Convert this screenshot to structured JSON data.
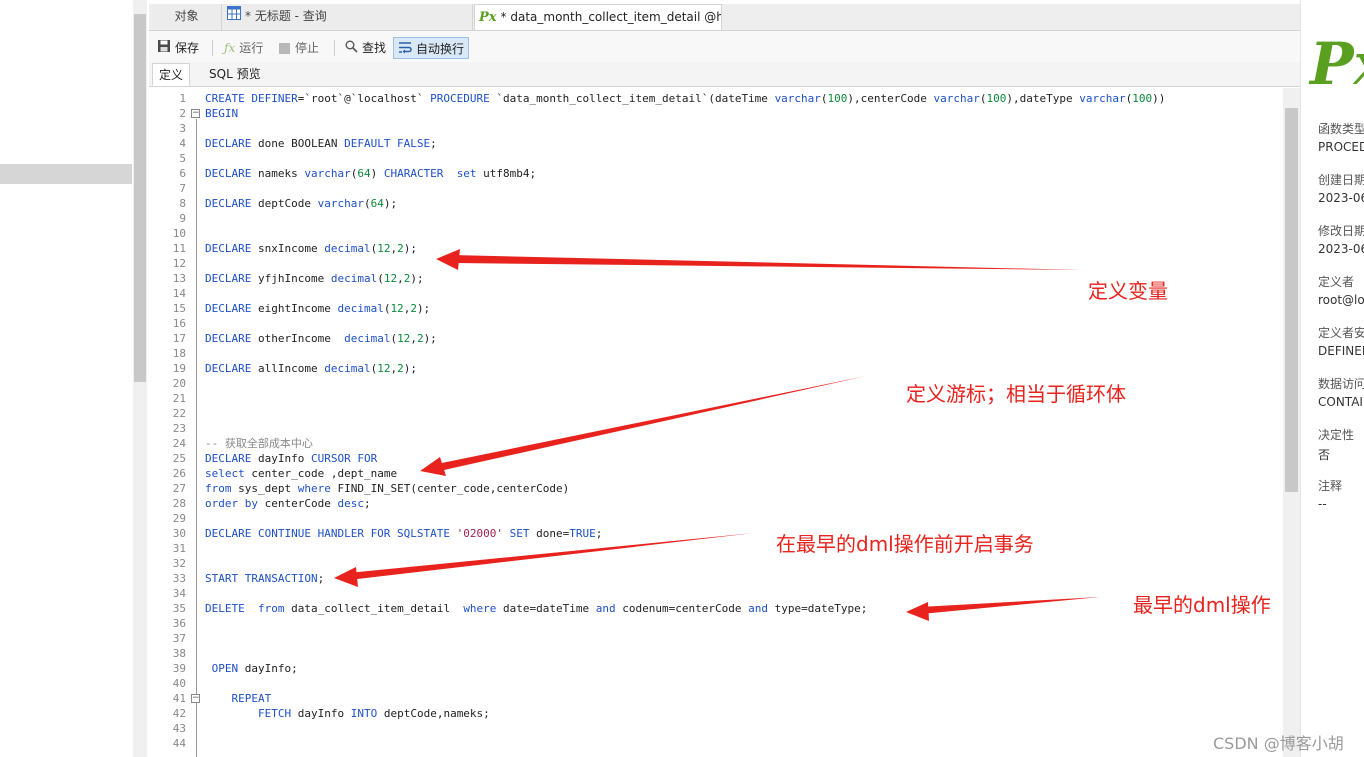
{
  "tabs": {
    "objects": "对象",
    "query": "* 无标题 - 查询",
    "procedure": "* data_month_collect_item_detail @h..."
  },
  "toolbar": {
    "save": "保存",
    "run": "运行",
    "stop": "停止",
    "find": "查找",
    "autowrap": "自动换行"
  },
  "subtabs": {
    "definition": "定义",
    "sql_preview": "SQL 预览"
  },
  "editor": {
    "line_numbers": [
      "1",
      "2",
      "3",
      "4",
      "5",
      "6",
      "7",
      "8",
      "9",
      "10",
      "11",
      "12",
      "13",
      "14",
      "15",
      "16",
      "17",
      "18",
      "19",
      "20",
      "21",
      "22",
      "23",
      "24",
      "25",
      "26",
      "27",
      "28",
      "29",
      "30",
      "31",
      "32",
      "33",
      "34",
      "35",
      "36",
      "37",
      "38",
      "39",
      "40",
      "41",
      "42",
      "43",
      "44"
    ]
  },
  "properties": {
    "logo": "Px",
    "function_type_label": "函数类型",
    "function_type_value": "PROCEDURE",
    "created_label": "创建日期",
    "created_value": "2023-06",
    "modified_label": "修改日期",
    "modified_value": "2023-06",
    "definer_label": "定义者",
    "definer_value": "root@localhost",
    "security_label": "定义者安全",
    "security_value": "DEFINER",
    "data_access_label": "数据访问",
    "data_access_value": "CONTAINS SQL",
    "deterministic_label": "决定性",
    "deterministic_value": "否",
    "comment_label": "注释",
    "comment_value": "--"
  },
  "annotations": {
    "define_variables": "定义变量",
    "define_cursor": "定义游标；相当于循环体",
    "open_transaction": "在最早的dml操作前开启事务",
    "earliest_dml": "最早的dml操作",
    "arrow_color": "#e8231e"
  },
  "watermark": "CSDN @博客小胡"
}
